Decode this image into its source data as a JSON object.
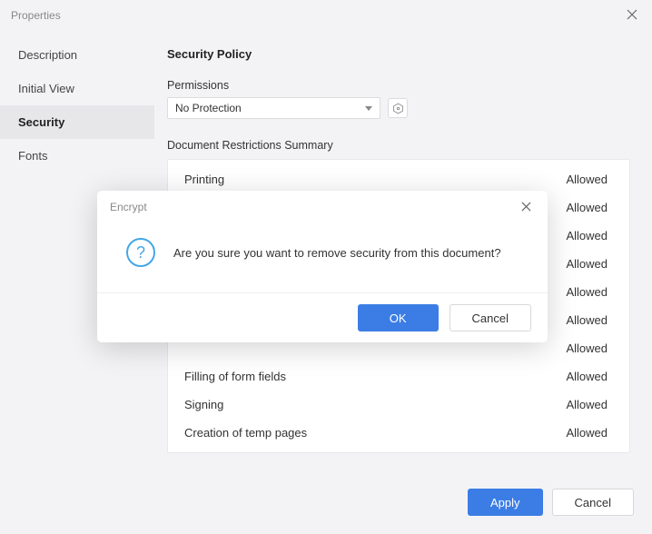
{
  "header": {
    "title": "Properties"
  },
  "sidebar": {
    "items": [
      {
        "label": "Description"
      },
      {
        "label": "Initial View"
      },
      {
        "label": "Security"
      },
      {
        "label": "Fonts"
      }
    ]
  },
  "main": {
    "heading": "Security Policy",
    "permissions_label": "Permissions",
    "permissions_value": "No Protection",
    "summary_label": "Document Restrictions Summary",
    "rows": [
      {
        "label": "Printing",
        "value": "Allowed"
      },
      {
        "label": "",
        "value": "Allowed"
      },
      {
        "label": "",
        "value": "Allowed"
      },
      {
        "label": "",
        "value": "Allowed"
      },
      {
        "label": "",
        "value": "Allowed"
      },
      {
        "label": "",
        "value": "Allowed"
      },
      {
        "label": "",
        "value": "Allowed"
      },
      {
        "label": "Filling of form fields",
        "value": "Allowed"
      },
      {
        "label": "Signing",
        "value": "Allowed"
      },
      {
        "label": "Creation of temp pages",
        "value": "Allowed"
      }
    ]
  },
  "footer": {
    "apply": "Apply",
    "cancel": "Cancel"
  },
  "modal": {
    "title": "Encrypt",
    "message": "Are you sure you want to remove security from this document?",
    "ok": "OK",
    "cancel": "Cancel"
  }
}
